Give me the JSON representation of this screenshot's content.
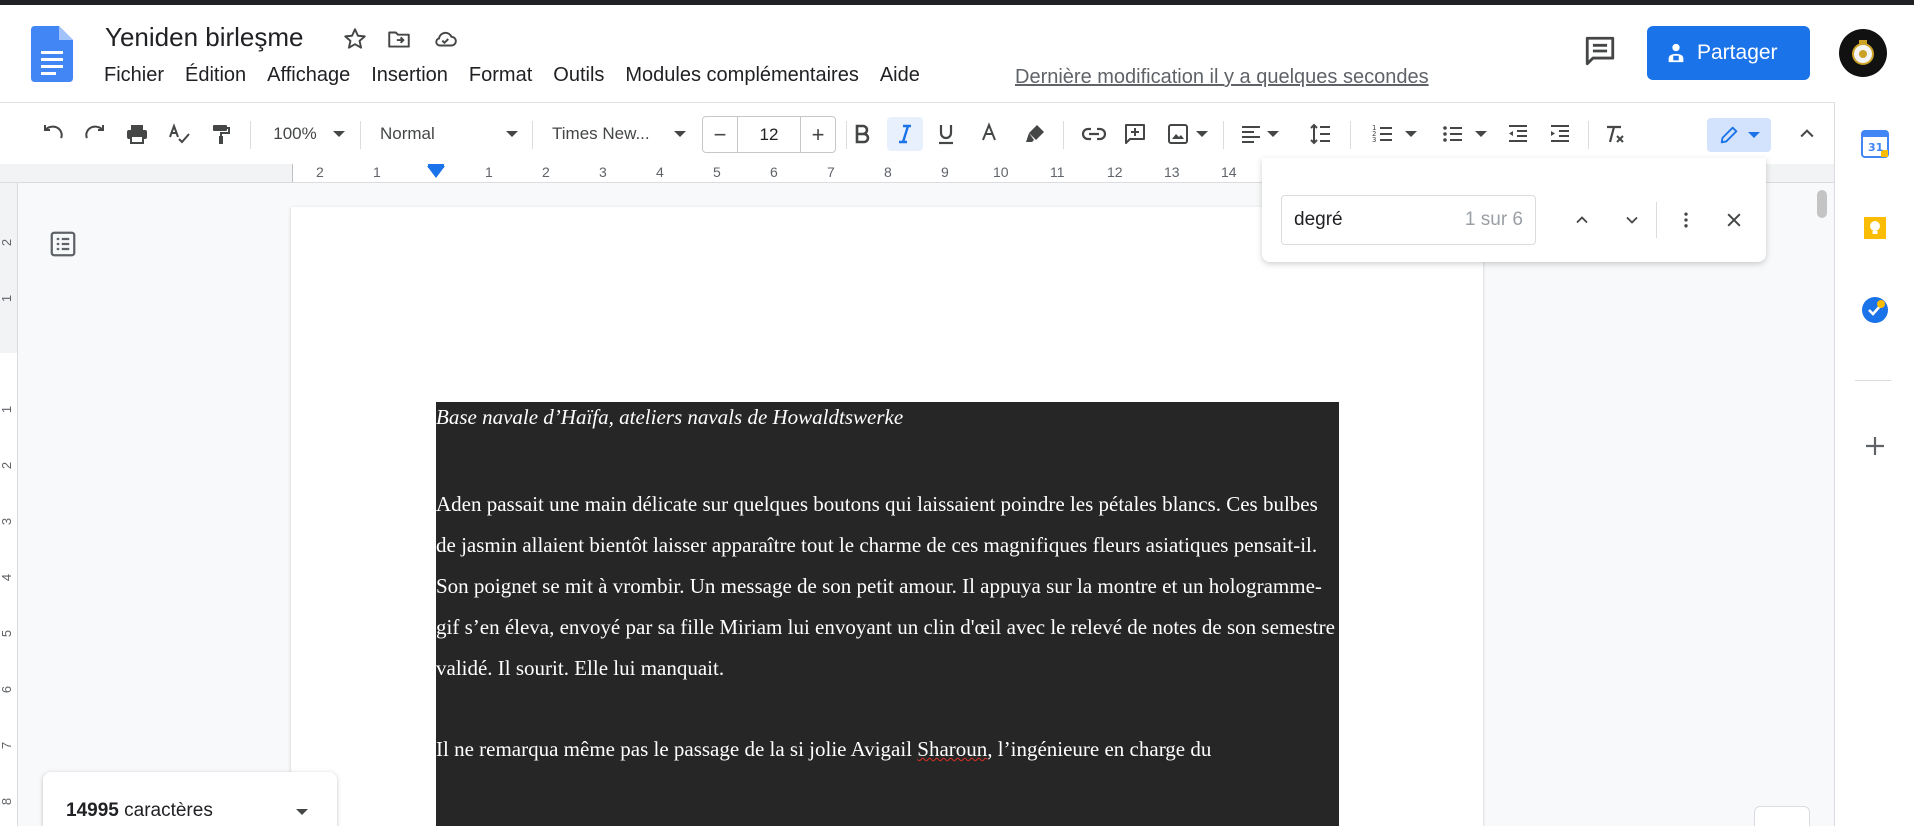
{
  "document": {
    "title": "Yeniden birleşme",
    "last_edit": "Dernière modification il y a quelques secondes"
  },
  "menu": [
    "Fichier",
    "Édition",
    "Affichage",
    "Insertion",
    "Format",
    "Outils",
    "Modules complémentaires",
    "Aide"
  ],
  "share": {
    "label": "Partager"
  },
  "toolbar": {
    "zoom": "100%",
    "style": "Normal",
    "font": "Times New...",
    "font_size": "12",
    "minus": "−",
    "plus": "+"
  },
  "ruler": {
    "numbers": [
      "2",
      "1",
      "1",
      "2",
      "3",
      "4",
      "5",
      "6",
      "7",
      "8",
      "9",
      "10",
      "11",
      "12",
      "13",
      "14"
    ]
  },
  "vruler": {
    "numbers": [
      "2",
      "1",
      "1",
      "2",
      "3",
      "4",
      "5",
      "6",
      "7",
      "8"
    ]
  },
  "find": {
    "query": "degré",
    "count": "1 sur 6"
  },
  "content": {
    "heading": "Base navale d’Haïfa, ateliers navals de Howaldtswerke",
    "para1": "Aden passait une main délicate sur quelques boutons qui laissaient poindre les pétales blancs. Ces bulbes de jasmin allaient bientôt laisser apparaître tout le charme de ces magnifiques fleurs asiatiques pensait-il. Son poignet se mit à vrombir. Un message de son petit amour. Il appuya sur la montre et un hologramme-gif s’en éleva, envoyé par sa fille Miriam lui envoyant un clin d'œil avec le relevé de notes de son semestre validé. Il sourit. Elle lui manquait.",
    "para2_start": "Il ne remarqua même pas le passage de la si jolie Avigail ",
    "para2_name": "Sharoun",
    "para2_end": ", l’ingénieure en charge du"
  },
  "wordcount": {
    "number": "14995",
    "label": " caractères"
  },
  "colors": {
    "accent": "#1a73e8",
    "block": "#262626"
  }
}
